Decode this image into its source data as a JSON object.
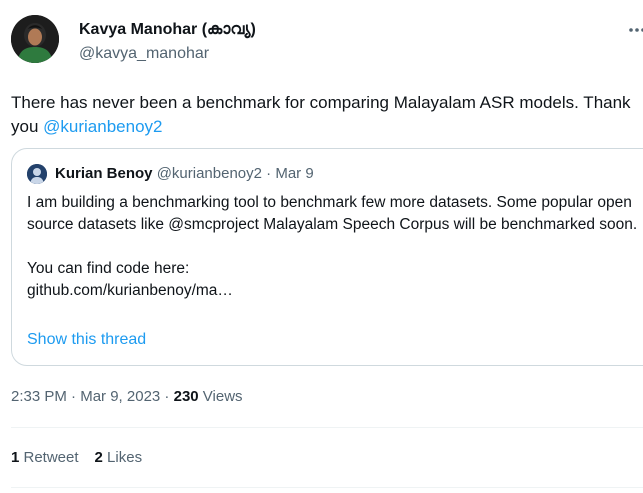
{
  "author": {
    "name": "Kavya Manohar (കാവ്യ)",
    "handle": "@kavya_manohar"
  },
  "tweet": {
    "text_before": "There has never been a benchmark for comparing Malayalam ASR models. Thank you ",
    "mention": "@kurianbenoy2"
  },
  "quote": {
    "author_name": "Kurian Benoy",
    "author_handle": "@kurianbenoy2",
    "separator": " · ",
    "date": "Mar 9",
    "paragraph1": "I am building a benchmarking tool to benchmark few more datasets. Some popular open source datasets like @smcproject Malayalam Speech Corpus will be benchmarked soon.",
    "paragraph2_line1": "You can find code here:",
    "paragraph2_line2": "github.com/kurianbenoy/ma…",
    "show_thread": "Show this thread"
  },
  "meta": {
    "time": "2:33 PM",
    "separator": " · ",
    "date": "Mar 9, 2023",
    "views_count": "230",
    "views_label": " Views"
  },
  "stats": {
    "retweets_count": "1",
    "retweets_label": " Retweet",
    "likes_count": "2",
    "likes_label": " Likes"
  },
  "icons": {
    "more": "more-horizontal-icon"
  },
  "colors": {
    "accent": "#1d9bf0",
    "secondary_text": "#536471",
    "primary_text": "#0f1419",
    "border": "#cfd9de"
  }
}
